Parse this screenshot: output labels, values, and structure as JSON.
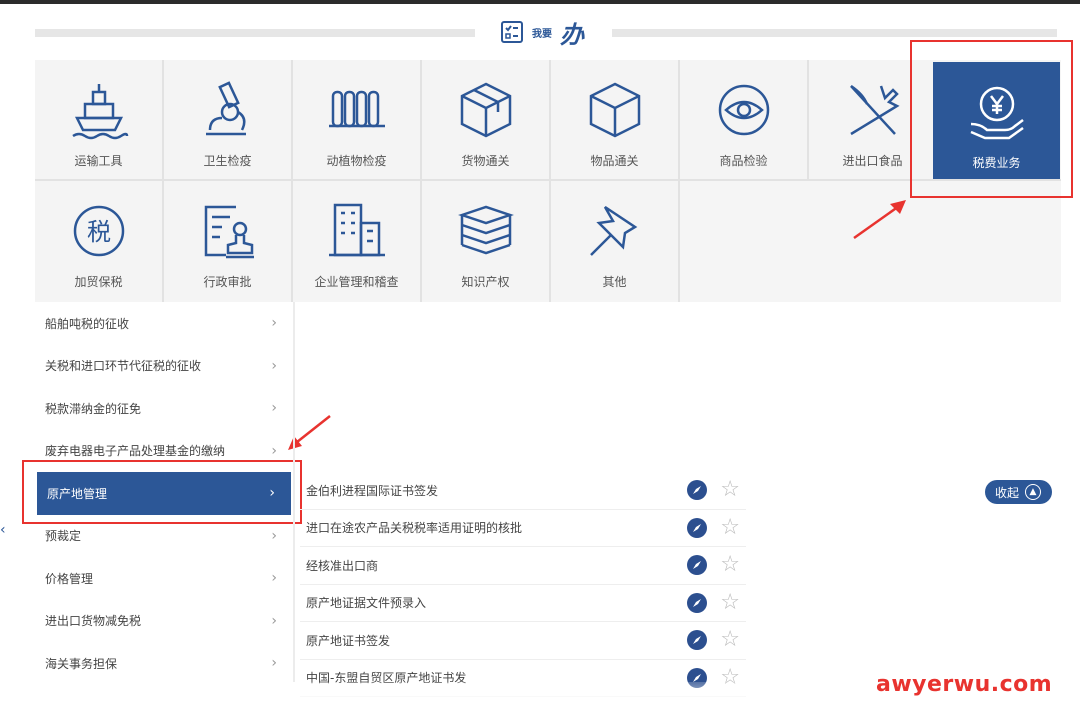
{
  "header": {
    "small_text": "我要",
    "big_text": "办"
  },
  "tiles": [
    {
      "label": "运输工具",
      "icon": "ship-icon"
    },
    {
      "label": "卫生检疫",
      "icon": "microscope-icon"
    },
    {
      "label": "动植物检疫",
      "icon": "plant-icon"
    },
    {
      "label": "货物通关",
      "icon": "package-icon"
    },
    {
      "label": "物品通关",
      "icon": "box-icon"
    },
    {
      "label": "商品检验",
      "icon": "eye-icon"
    },
    {
      "label": "进出口食品",
      "icon": "utensils-icon"
    },
    {
      "label": "税费业务",
      "icon": "yen-hand-icon"
    },
    {
      "label": "加贸保税",
      "icon": "tax-icon"
    },
    {
      "label": "行政审批",
      "icon": "approval-icon"
    },
    {
      "label": "企业管理和稽查",
      "icon": "building-icon"
    },
    {
      "label": "知识产权",
      "icon": "books-icon"
    },
    {
      "label": "其他",
      "icon": "pin-icon"
    }
  ],
  "menu": [
    {
      "label": "船舶吨税的征收"
    },
    {
      "label": "关税和进口环节代征税的征收"
    },
    {
      "label": "税款滞纳金的征免"
    },
    {
      "label": "废弃电器电子产品处理基金的缴纳"
    },
    {
      "label": "原产地管理"
    },
    {
      "label": "预裁定"
    },
    {
      "label": "价格管理"
    },
    {
      "label": "进出口货物减免税"
    },
    {
      "label": "海关事务担保"
    }
  ],
  "items": [
    {
      "label": "金伯利进程国际证书签发"
    },
    {
      "label": "进口在途农产品关税税率适用证明的核批"
    },
    {
      "label": "经核准出口商"
    },
    {
      "label": "原产地证据文件预录入"
    },
    {
      "label": "原产地证书签发"
    },
    {
      "label": "中国-东盟自贸区原产地证书发"
    }
  ],
  "collapse_label": "收起",
  "watermark": "awyerwu.com",
  "colors": {
    "brand": "#2c5797",
    "highlight": "#e8332f"
  },
  "active_tile": "税费业务",
  "active_menu": "原产地管理"
}
